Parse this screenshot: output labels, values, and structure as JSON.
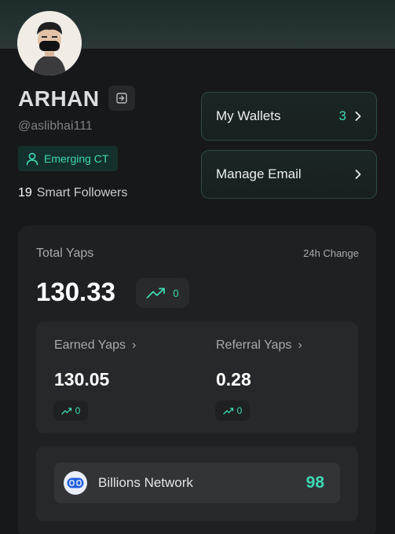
{
  "profile": {
    "name": "ARHAN",
    "handle": "@aslibhai111",
    "badge": "Emerging CT",
    "smart_followers_count": "19",
    "smart_followers_label": "Smart Followers"
  },
  "actions": {
    "wallets_label": "My Wallets",
    "wallets_count": "3",
    "email_label": "Manage Email"
  },
  "yaps": {
    "total_label": "Total Yaps",
    "change_label": "24h Change",
    "total_value": "130.33",
    "total_change": "0",
    "earned_label": "Earned Yaps",
    "earned_value": "130.05",
    "earned_change": "0",
    "referral_label": "Referral Yaps",
    "referral_value": "0.28",
    "referral_change": "0"
  },
  "networks": [
    {
      "name": "Billions Network",
      "score": "98"
    }
  ],
  "icons": {
    "logout": "logout-icon",
    "user": "user-icon",
    "chevron": "chevron-right-icon",
    "trend": "trend-up-icon"
  },
  "colors": {
    "accent": "#3fd9b3",
    "background": "#17181a",
    "panel": "#1f2022"
  }
}
